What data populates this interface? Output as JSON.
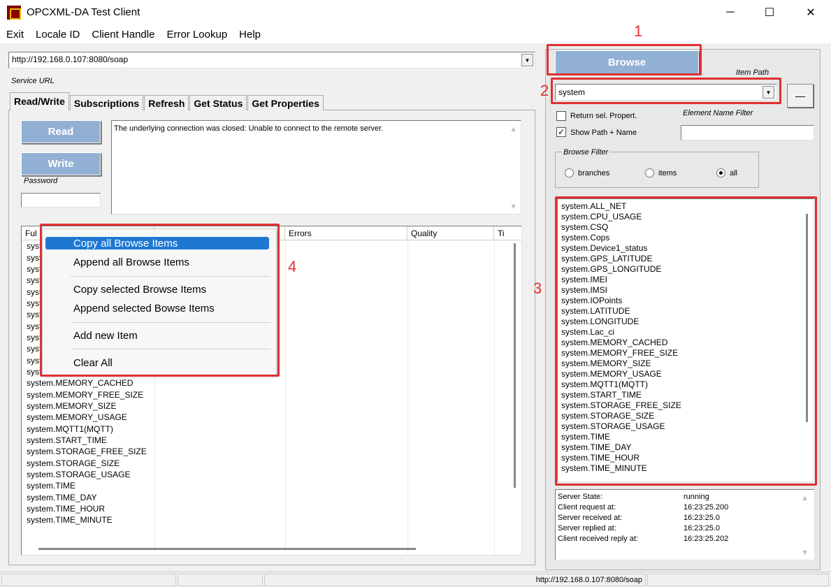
{
  "window": {
    "title": "OPCXML-DA Test Client",
    "minimize": "─",
    "maximize": "☐",
    "close": "✕"
  },
  "menu": [
    "Exit",
    "Locale ID",
    "Client Handle",
    "Error Lookup",
    "Help"
  ],
  "service": {
    "url": "http://192.168.0.107:8080/soap",
    "url_label": "Service URL"
  },
  "tabs": [
    "Read/Write",
    "Subscriptions",
    "Refresh",
    "Get Status",
    "Get Properties"
  ],
  "read_write": {
    "read_label": "Read",
    "write_label": "Write",
    "password_label": "Password",
    "message": "The underlying connection was closed: Unable to connect to the remote server."
  },
  "table": {
    "columns": [
      "Ful",
      "",
      "Errors",
      "Quality",
      "Ti"
    ],
    "rows": [
      "system",
      "syst",
      "syst",
      "syst",
      "syst",
      "syst",
      "syst",
      "syst",
      "syst",
      "syst",
      "syst",
      "system.Lac_ci",
      "system.MEMORY_CACHED",
      "system.MEMORY_FREE_SIZE",
      "system.MEMORY_SIZE",
      "system.MEMORY_USAGE",
      "system.MQTT1(MQTT)",
      "system.START_TIME",
      "system.STORAGE_FREE_SIZE",
      "system.STORAGE_SIZE",
      "system.STORAGE_USAGE",
      "system.TIME",
      "system.TIME_DAY",
      "system.TIME_HOUR",
      "system.TIME_MINUTE"
    ]
  },
  "context_menu": {
    "copy_all": "Copy all Browse Items",
    "append_all": "Append all Browse Items",
    "copy_selected": "Copy selected Browse Items",
    "append_selected": "Append selected Bowse Items",
    "add_new": "Add new Item",
    "clear_all": "Clear All"
  },
  "browse": {
    "button_label": "Browse",
    "item_path_label": "Item Path",
    "item_path_value": "system",
    "ellipsis_label": "—",
    "return_props_label": "Return sel. Propert.",
    "show_path_label": "Show Path + Name",
    "elem_filter_label": "Element Name Filter",
    "filter_group_label": "Browse Filter",
    "filter_options": [
      "branches",
      "items",
      "all"
    ],
    "selected_filter": "all",
    "items": [
      "system.ALL_NET",
      "system.CPU_USAGE",
      "system.CSQ",
      "system.Cops",
      "system.Device1_status",
      "system.GPS_LATITUDE",
      "system.GPS_LONGITUDE",
      "system.IMEI",
      "system.IMSI",
      "system.IOPoints",
      "system.LATITUDE",
      "system.LONGITUDE",
      "system.Lac_ci",
      "system.MEMORY_CACHED",
      "system.MEMORY_FREE_SIZE",
      "system.MEMORY_SIZE",
      "system.MEMORY_USAGE",
      "system.MQTT1(MQTT)",
      "system.START_TIME",
      "system.STORAGE_FREE_SIZE",
      "system.STORAGE_SIZE",
      "system.STORAGE_USAGE",
      "system.TIME",
      "system.TIME_DAY",
      "system.TIME_HOUR",
      "system.TIME_MINUTE"
    ]
  },
  "status": {
    "rows": [
      {
        "key": "Server State:",
        "value": "running"
      },
      {
        "key": "Client request at:",
        "value": "16:23:25.200"
      },
      {
        "key": "Server received at:",
        "value": "16:23:25.0"
      },
      {
        "key": "Server replied at:",
        "value": "16:23:25.0"
      },
      {
        "key": "Client received reply at:",
        "value": "16:23:25.202"
      }
    ]
  },
  "statusbar": {
    "url": "http://192.168.0.107:8080/soap"
  },
  "annotations": [
    "1",
    "2",
    "3",
    "4"
  ],
  "colors": {
    "annotation_red": "#e03030",
    "button_blue": "#92b0d4",
    "menu_highlight": "#1e78d2"
  }
}
